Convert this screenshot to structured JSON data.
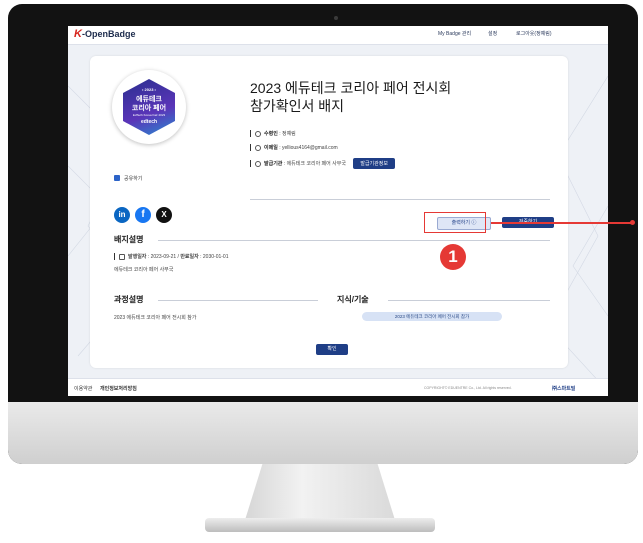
{
  "app": {
    "logo_k": "K",
    "logo_rest": "-OpenBadge"
  },
  "nav": {
    "my_badge": "My Badge 관리",
    "settings": "설정",
    "logout": "로그아웃(정예림)"
  },
  "badge": {
    "year": "• 2023 •",
    "line1": "에듀테크",
    "line2": "코리아 페어",
    "sub": "EdTech Korea Fair 2023",
    "brand": "edtech"
  },
  "title": {
    "line1": "2023 에듀테크 코리아 페어 전시회",
    "line2": "참가확인서 배지"
  },
  "info": {
    "recipient_label": "수령인",
    "recipient": "정예림",
    "email_label": "이메일",
    "email": "yellious4164@gmail.com",
    "issuer_label": "발급기관",
    "issuer": "에듀테크 코리아 페어 사무국",
    "issuer_button": "발급기관정보"
  },
  "share": {
    "label": "공유하기",
    "checked": true
  },
  "social": {
    "linkedin": "in",
    "facebook": "f",
    "x": "X"
  },
  "buttons": {
    "print": "출력하기 ⓘ",
    "verify": "검증하기",
    "ok": "확인"
  },
  "step_number": "1",
  "badge_desc": {
    "title": "배지설명",
    "issue_label": "발행일자",
    "issue_date": "2023-09-21",
    "expire_label": "만료일자",
    "expire_date": "2030-01-01",
    "desc": "에듀테크 코리아 페어 사무국"
  },
  "course": {
    "title": "과정설명",
    "text": "2023 에듀테크 코리아 페어 전시회 참가"
  },
  "skills": {
    "title": "지식/기술",
    "tag": "2023 에듀테크 코리아 페어 전시회 참가"
  },
  "footer": {
    "terms": "이용약관",
    "privacy": "개인정보처리방침",
    "copyright": "COPYRIGHT© EDUENTRE Co., Ltd. All rights reserved.",
    "company": "㈜스마트빌"
  },
  "colors": {
    "accent": "#1f3e86",
    "highlight": "#e53935",
    "check": "#2c63c8"
  }
}
